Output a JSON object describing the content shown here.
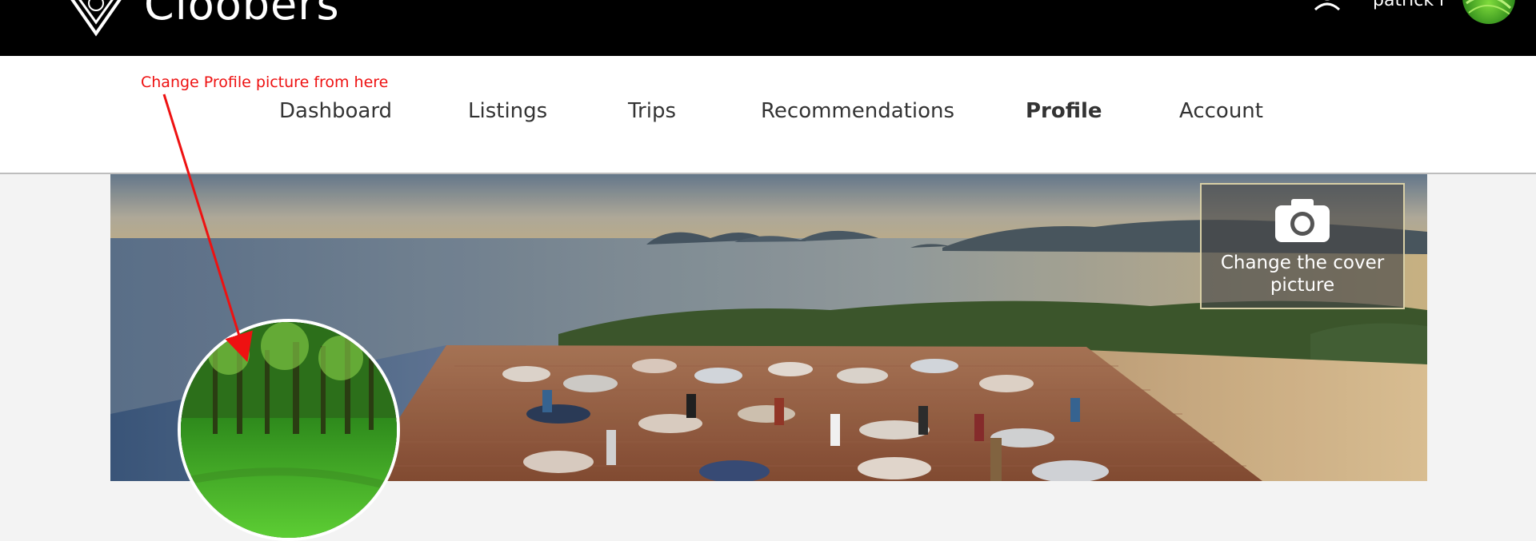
{
  "header": {
    "brand": "Cloobers",
    "username": "patrick r"
  },
  "nav": {
    "items": [
      {
        "label": "Dashboard",
        "active": false
      },
      {
        "label": "Listings",
        "active": false
      },
      {
        "label": "Trips",
        "active": false
      },
      {
        "label": "Recommendations",
        "active": false
      },
      {
        "label": "Profile",
        "active": true
      },
      {
        "label": "Account",
        "active": false
      }
    ]
  },
  "annotation": {
    "text": "Change Profile picture from here",
    "color": "#e11"
  },
  "cover": {
    "change_label": "Change the cover picture",
    "icon": "camera-icon"
  },
  "icons": {
    "logo": "logo-shield-icon",
    "user": "user-icon"
  },
  "colors": {
    "header_bg": "#000000",
    "nav_bg": "#ffffff",
    "page_bg": "#f3f3f3",
    "annotation": "#ee1111"
  }
}
